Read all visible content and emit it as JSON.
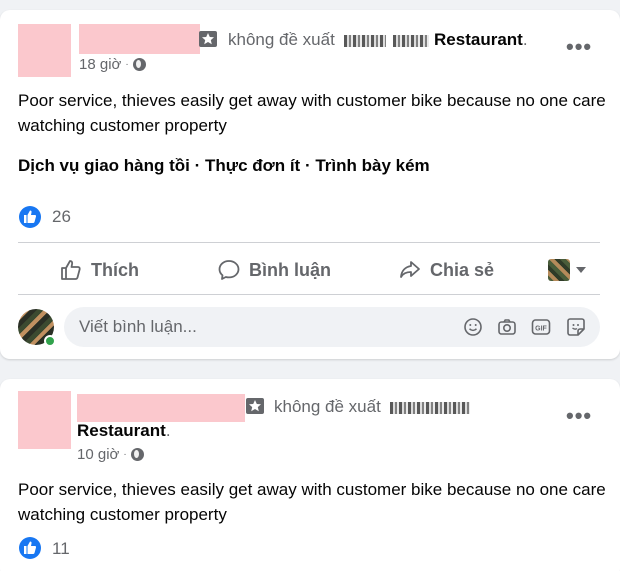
{
  "posts": [
    {
      "recommend_text": "không đề xuất",
      "restaurant": "Restaurant",
      "restaurant_suffix": ".",
      "time": "18 giờ",
      "visibility_icon": "globe-icon",
      "body": "Poor service, thieves easily get away with customer bike because no one care watching customer property",
      "tags": "Dịch vụ giao hàng tồi · Thực đơn ít · Trình bày kém",
      "like_count": "26"
    },
    {
      "recommend_text": "không đề xuất",
      "restaurant": "Restaurant",
      "restaurant_suffix": ".",
      "time": "10 giờ",
      "visibility_icon": "globe-icon",
      "body": "Poor service, thieves easily get away with customer bike because no one care watching customer property",
      "like_count": "11"
    }
  ],
  "actions": {
    "like": "Thích",
    "comment": "Bình luận",
    "share": "Chia sẻ"
  },
  "comment_box": {
    "placeholder": "Viết bình luận..."
  },
  "colors": {
    "accent": "#1877f2",
    "muted": "#65676b",
    "redacted": "#fbc8cd",
    "online": "#31a24c"
  }
}
